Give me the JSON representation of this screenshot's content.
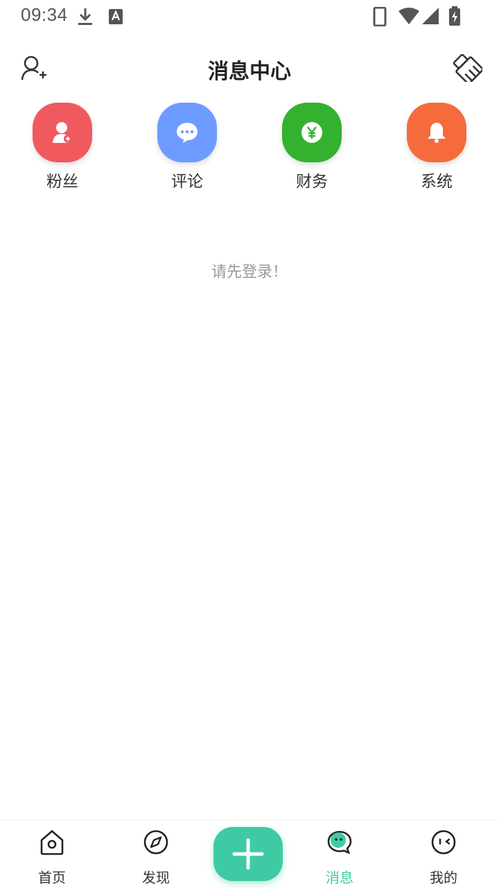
{
  "status_bar": {
    "time": "09:34"
  },
  "header": {
    "title": "消息中心"
  },
  "categories": [
    {
      "label": "粉丝",
      "color": "#f05a5e",
      "icon": "add-user-icon"
    },
    {
      "label": "评论",
      "color": "#6d9bff",
      "icon": "chat-bubble-icon"
    },
    {
      "label": "财务",
      "color": "#34b12f",
      "icon": "yen-coin-icon"
    },
    {
      "label": "系统",
      "color": "#f56b3b",
      "icon": "bell-icon"
    }
  ],
  "empty_state": {
    "message": "请先登录！"
  },
  "tabbar": {
    "tabs": [
      {
        "label": "首页",
        "icon": "home-icon"
      },
      {
        "label": "发现",
        "icon": "compass-icon"
      },
      {
        "label": "消息",
        "icon": "message-icon",
        "active": true
      },
      {
        "label": "我的",
        "icon": "profile-face-icon"
      }
    ],
    "add_icon": "plus-icon",
    "accent": "#3ecba4"
  }
}
